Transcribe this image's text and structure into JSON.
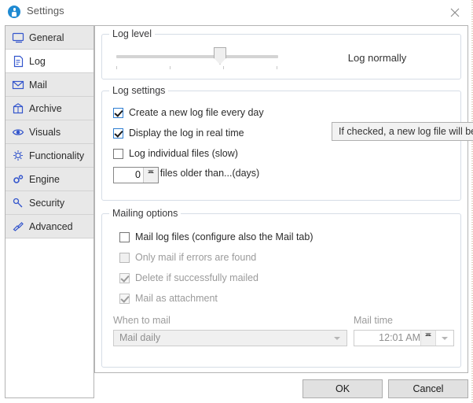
{
  "window": {
    "title": "Settings",
    "app_icon": "settings-person-icon",
    "close_icon": "close-icon"
  },
  "sidebar": {
    "items": [
      {
        "label": "General",
        "icon": "monitor-icon",
        "selected": false
      },
      {
        "label": "Log",
        "icon": "document-icon",
        "selected": true
      },
      {
        "label": "Mail",
        "icon": "envelope-icon",
        "selected": false
      },
      {
        "label": "Archive",
        "icon": "box-icon",
        "selected": false
      },
      {
        "label": "Visuals",
        "icon": "eye-icon",
        "selected": false
      },
      {
        "label": "Functionality",
        "icon": "lightbulb-icon",
        "selected": false
      },
      {
        "label": "Engine",
        "icon": "gears-icon",
        "selected": false
      },
      {
        "label": "Security",
        "icon": "key-icon",
        "selected": false
      },
      {
        "label": "Advanced",
        "icon": "screwdriver-icon",
        "selected": false
      }
    ]
  },
  "log_level": {
    "group_title": "Log level",
    "value_text": "Log normally",
    "slider_positions": 4,
    "slider_value": 3
  },
  "log_settings": {
    "group_title": "Log settings",
    "checkboxes": [
      {
        "label": "Create a new log file every day",
        "checked": true,
        "enabled": true
      },
      {
        "label": "Display the log in real time",
        "checked": true,
        "enabled": true
      },
      {
        "label": "Log individual files (slow)",
        "checked": false,
        "enabled": true
      }
    ],
    "delete_label": "Delete log files older than...(days)",
    "delete_value": "0"
  },
  "mailing_options": {
    "group_title": "Mailing options",
    "checkboxes": [
      {
        "label": "Mail log files (configure also the Mail tab)",
        "checked": false,
        "enabled": true
      },
      {
        "label": "Only mail if errors are found",
        "checked": false,
        "enabled": false
      },
      {
        "label": "Delete if successfully mailed",
        "checked": true,
        "enabled": false
      },
      {
        "label": "Mail as attachment",
        "checked": true,
        "enabled": false
      }
    ],
    "when_label": "When to mail",
    "when_value": "Mail daily",
    "time_label": "Mail time",
    "time_value": "12:01 AM"
  },
  "tooltip": {
    "text": "If checked, a new log file will be"
  },
  "buttons": {
    "ok": "OK",
    "cancel": "Cancel"
  },
  "colors": {
    "accent": "#2d7dd2",
    "icon_blue": "#3355cc",
    "group_border": "#d6dde6",
    "panel_border": "#b4b4b4",
    "nav_unselected": "#e8e8e8"
  }
}
